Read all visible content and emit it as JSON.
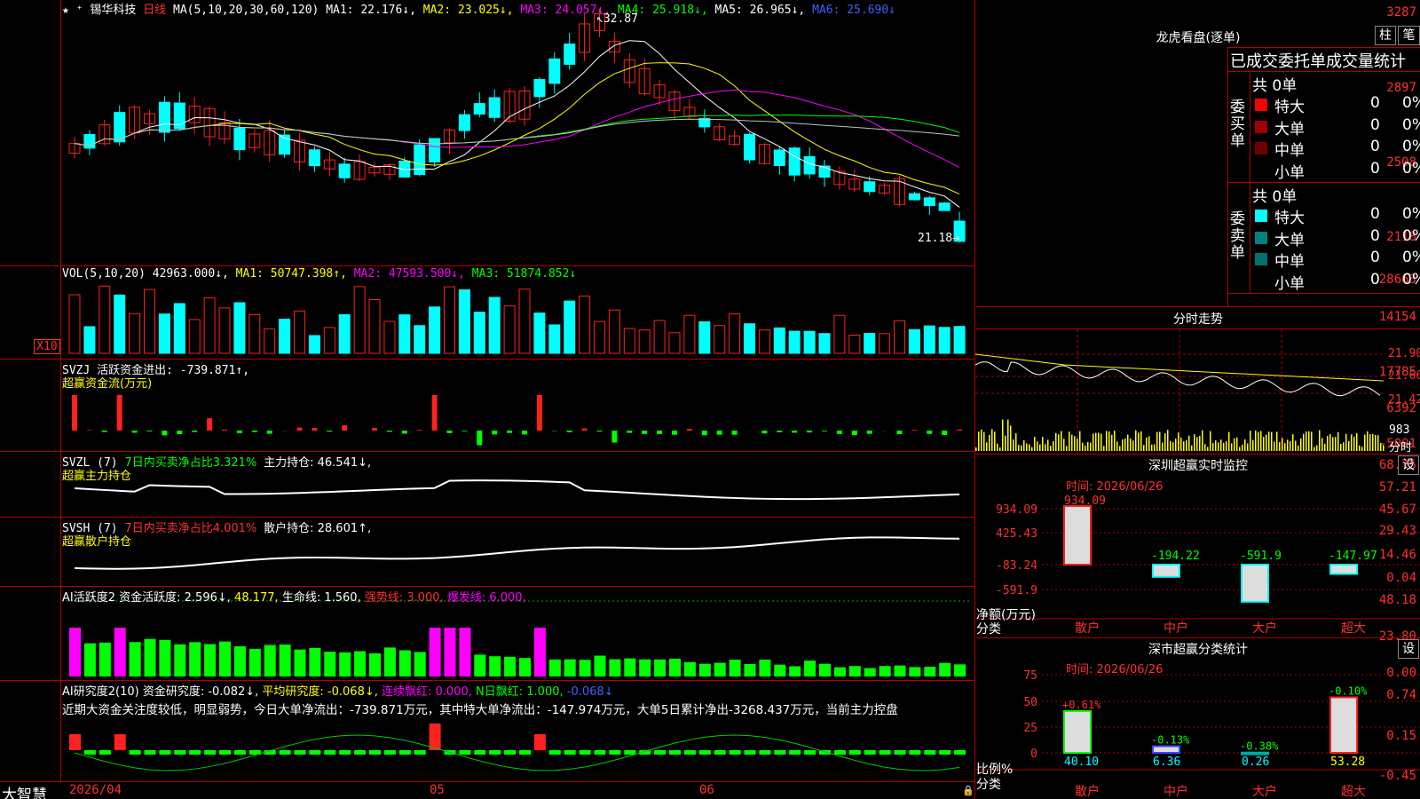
{
  "colors": {
    "up": "#ff2020",
    "down": "#00ffff",
    "grid": "#b00000",
    "ma1": "#ffffff",
    "ma2": "#ffff00",
    "ma3": "#ff00ff",
    "ma4": "#00ff00",
    "ma5": "#c0c0c0"
  },
  "main": {
    "title_icon": "star-icon",
    "stock_name": "锡华科技",
    "period": "日线",
    "ma_params": "MA(5,10,20,30,60,120)",
    "ma1": "MA1: 22.176↓,",
    "ma2": "MA2: 23.025↓,",
    "ma3": "MA3: 24.057↓,",
    "ma4": "MA4: 25.918↓,",
    "ma5": "MA5: 26.965↓,",
    "ma6": "MA6: 25.690↓",
    "y_labels": [
      "3287",
      "2897",
      "2508",
      "2118"
    ],
    "high_label": "32.87",
    "low_label": "21.18"
  },
  "vol": {
    "params": "VOL(5,10,20)",
    "value": "42963.000↓,",
    "ma1": "MA1: 50747.398↑,",
    "ma2": "MA2: 47593.500↓,",
    "ma3": "MA3: 51874.852↓",
    "y_labels": [
      "28663",
      "14154"
    ],
    "unit": "X10"
  },
  "svzj": {
    "title": "SVZJ  活跃资金进出: -739.871↑,",
    "subtitle": "超赢资金流(万元)",
    "y_labels": [
      "17785",
      "6392",
      "-5001"
    ]
  },
  "svzl": {
    "name": "SVZL (7)",
    "desc": "7日内买卖净占比3.321%",
    "hold": "主力持仓: 46.541↓,",
    "subtitle": "超赢主力持仓",
    "y_labels": [
      "68.75",
      "57.21",
      "45.67"
    ]
  },
  "svsh": {
    "name": "SVSH (7)",
    "desc": "7日内买卖净占比4.001%",
    "hold": "散户持仓: 28.601↑,",
    "subtitle": "超赢散户持仓",
    "y_labels": [
      "29.43",
      "14.46",
      "0.04"
    ]
  },
  "ai1": {
    "name": "AI活跃度2",
    "a": "资金活跃度: 2.596↓,",
    "b": "48.177,",
    "c": "生命线: 1.560,",
    "d": "强势线: 3.000,",
    "e": "爆发线: 6.000,",
    "y_labels": [
      "48.18",
      "23.80",
      "0.00"
    ]
  },
  "ai2": {
    "name": "AI研究度2(10)",
    "a": "资金研究度: -0.082↓,",
    "b": "平均研究度: -0.068↓,",
    "c": "连续飘红: 0.000,",
    "d": "N日飘红: 1.000,",
    "e": "-0.068↓",
    "text": "近期大资金关注度较低，明显弱势，今日大单净流出：-739.871万元，其中特大单净流出：-147.974万元，大单5日累计净出-3268.437万元，当前主力控盘",
    "y_labels": [
      "0.74",
      "0.15",
      "-0.45"
    ]
  },
  "xaxis": {
    "brand": "大智慧",
    "labels": [
      "2026/04",
      "05",
      "06"
    ]
  },
  "dragon": {
    "title": "龙虎看盘(逐单)",
    "btn1": "柱",
    "btn2": "笔",
    "header": "已成交委托单成交量统计",
    "buy_label": "委买单",
    "sell_label": "委卖单",
    "buy_total": "共 0单",
    "sell_total": "共 0单",
    "buy_rows": [
      {
        "name": "特大",
        "val": "0",
        "pct": "0%",
        "color": "#ff0000"
      },
      {
        "name": "大单",
        "val": "0",
        "pct": "0%",
        "color": "#a00000"
      },
      {
        "name": "中单",
        "val": "0",
        "pct": "0%",
        "color": "#700000"
      },
      {
        "name": "小单",
        "val": "0",
        "pct": "0%",
        "color": ""
      }
    ],
    "sell_rows": [
      {
        "name": "特大",
        "val": "0",
        "pct": "0%",
        "color": "#00ffff"
      },
      {
        "name": "大单",
        "val": "0",
        "pct": "0%",
        "color": "#008080"
      },
      {
        "name": "中单",
        "val": "0",
        "pct": "0%",
        "color": "#007070"
      },
      {
        "name": "小单",
        "val": "0",
        "pct": "0%",
        "color": ""
      }
    ]
  },
  "intraday": {
    "title": "分时走势",
    "y_labels": [
      "21.90",
      "21.66",
      "21.42"
    ],
    "vol_label": "983",
    "unit": "分时"
  },
  "monitor": {
    "title": "深圳超赢实时监控",
    "btn": "设",
    "time": "时间: 2026/06/26",
    "y_labels": [
      "934.09",
      "425.43",
      "-83.24",
      "-591.9"
    ],
    "axis_label": "净额(万元)",
    "cat_label": "分类",
    "cats": [
      "散户",
      "中户",
      "大户",
      "超大"
    ],
    "values": [
      934.09,
      -194.22,
      -591.9,
      -147.97
    ],
    "value_labels": [
      "934.09",
      "-194.22",
      "-591.9",
      "-147.97"
    ]
  },
  "classify": {
    "title": "深市超赢分类统计",
    "btn": "设",
    "time": "时间: 2026/06/26",
    "y_labels": [
      "75",
      "50",
      "25",
      "0"
    ],
    "axis_label": "比例%",
    "cat_label": "分类",
    "cats": [
      "散户",
      "中户",
      "大户",
      "超大"
    ],
    "values": [
      40.1,
      6.36,
      0.26,
      53.28
    ],
    "value_labels": [
      "40.10",
      "6.36",
      "0.26",
      "53.28"
    ],
    "change_labels": [
      "+0.61%",
      "-0.13%",
      "-0.38%",
      "-0.10%"
    ]
  }
}
